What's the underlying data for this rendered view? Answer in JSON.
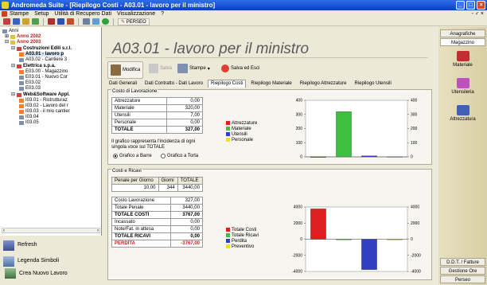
{
  "window": {
    "title": "Andromeda Suite - [Riepilogo Costi - A03.01 - lavoro per il ministro]"
  },
  "menu": [
    "Stampe",
    "Setup",
    "Utilità di Recupero Dati",
    "Visualizzazione",
    "?"
  ],
  "menu_mdi": "- ♂ ×",
  "toolbar": {
    "perseo_label": "PERSEO"
  },
  "tree": {
    "root": "Anni",
    "year1": "Anno 2002",
    "year2": "Anno 2003",
    "client1": "Costruzioni Edili s.r.l.",
    "job1": "A03.01 - lavoro p",
    "job2": "A03.02 - Cantiere 3",
    "client2": "Elettrica s.p.a.",
    "job3": "E03.00 - Magazzino",
    "job4": "E03.01 - Nuovo Cor",
    "job5": "E03.02",
    "job6": "E03.03",
    "client3": "Web&Software Appl.",
    "job7": "I03.01 - Ristrutturaz",
    "job8": "I03.02 - Lavoro del r",
    "job9": "I03.03 - il mio cantier",
    "job10": "I03.04",
    "job11": "I03.05"
  },
  "left_buttons": {
    "refresh": "Refresh",
    "legend": "Legenda Simboli",
    "new_job": "Crea Nuovo Lavoro"
  },
  "header": {
    "title": "A03.01 - lavoro per il ministro"
  },
  "actions": {
    "modify": "Modifica",
    "delete": "Salva",
    "print": "Stampe",
    "save_exit": "Salva ed Esci"
  },
  "tabs": [
    "Dati Generali",
    "Dati Contratto - Dati Lavoro",
    "Riepilogo Costi",
    "Riepilogo Materiale",
    "Riepilogo Attrezzature",
    "Riepilogo Utensili"
  ],
  "costi": {
    "title": "Costo di Lavorazione",
    "rows": [
      {
        "label": "Attrezzature",
        "value": "0,00"
      },
      {
        "label": "Materiale",
        "value": "320,00"
      },
      {
        "label": "Utensili",
        "value": "7,00"
      },
      {
        "label": "Personale",
        "value": "0,00"
      },
      {
        "label": "TOTALE",
        "value": "327,00"
      }
    ],
    "note": "Il grafico rappresenta l'incidenza di ogni singola voce sul TOTALE",
    "radio_bars": "Grafico a Barre",
    "radio_pie": "Grafico a Torta"
  },
  "ricavi": {
    "title": "Costi e Ricavi",
    "penale_headers": [
      "Penale per Giorno",
      "Giorni",
      "TOTALE"
    ],
    "penale_values": [
      "10,00",
      "344",
      "3440,00"
    ],
    "rows": [
      {
        "label": "Costo Lavorazione",
        "value": "327,00"
      },
      {
        "label": "Totale Penale",
        "value": "3440,00"
      },
      {
        "label": "TOTALE COSTI",
        "value": "3767,00"
      },
      {
        "label": "Incassato",
        "value": "0,00"
      },
      {
        "label": "Note/Fat. in attesa",
        "value": "0,00"
      },
      {
        "label": "TOTALE RICAVI",
        "value": "0,00"
      },
      {
        "label": "PERDITA",
        "value": "-3767,00"
      }
    ]
  },
  "chart_data": [
    {
      "type": "bar",
      "categories": [
        "Attrezzature",
        "Materiale",
        "Utensili",
        "Personale"
      ],
      "values": [
        0,
        320,
        7,
        0
      ],
      "colors": [
        "#e02020",
        "#40c040",
        "#3040c0",
        "#f0e020"
      ],
      "ylim": [
        0,
        400
      ],
      "yticks": [
        "400",
        "300",
        "200",
        "100",
        "0"
      ],
      "legend_placement": "left"
    },
    {
      "type": "bar",
      "categories": [
        "Totale Costi",
        "Totale Ricavi",
        "Perdita",
        "Preventivo"
      ],
      "values": [
        3767,
        0,
        -3767,
        0
      ],
      "colors": [
        "#e02020",
        "#40c040",
        "#3040c0",
        "#f0e020"
      ],
      "ylim": [
        -4000,
        4000
      ],
      "yticks": [
        "4000",
        "2000",
        "0",
        "-2000",
        "-4000"
      ],
      "legend_placement": "left"
    }
  ],
  "right": {
    "tab_anagrafiche": "Anagrafiche",
    "tab_magazzino": "Magazzino",
    "item_materiale": "Materiale",
    "item_utensileria": "Utensileria",
    "item_attrezzatura": "Attrezzatura",
    "tab_ddt": "D.D.T. / Fatture",
    "tab_gestione_ore": "Gestione Ore",
    "tab_perseo": "Perseo"
  },
  "colors": {
    "title_bar": "#0a3fc4",
    "accent_red": "#e02020"
  }
}
